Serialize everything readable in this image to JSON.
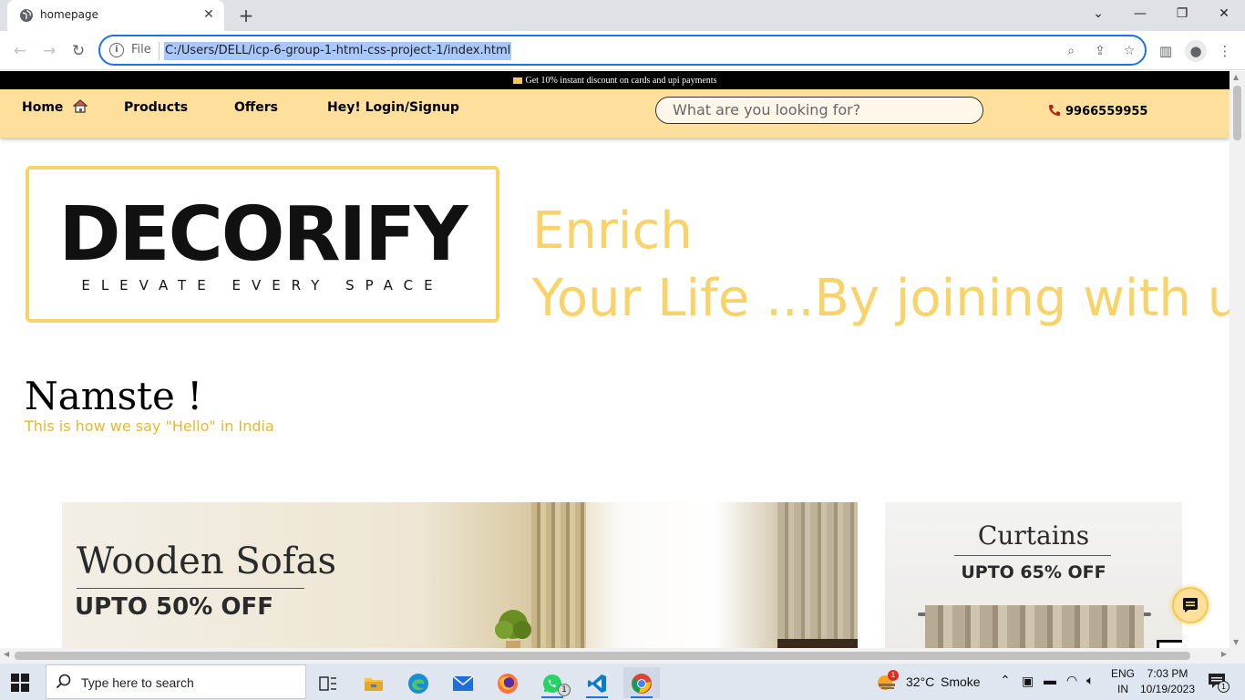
{
  "browser": {
    "tab_title": "homepage",
    "omnibox_scheme": "File",
    "url": "C:/Users/DELL/icp-6-group-1-html-css-project-1/index.html"
  },
  "site": {
    "promo": "Get 10% instant discount on cards and upi payments",
    "nav": {
      "home": "Home",
      "products": "Products",
      "offers": "Offers",
      "login": "Hey! Login/Signup"
    },
    "search_placeholder": "What are you looking for?",
    "phone": "9966559955",
    "logo_title": "DECORIFY",
    "logo_tagline": "ELEVATE EVERY SPACE",
    "hero_line1": "Enrich",
    "hero_line2": "Your Life ...By joining with us!",
    "greeting": "Namste !",
    "greeting_sub": "This is how we say \"Hello\" in India",
    "banners": [
      {
        "title": "Wooden Sofas",
        "offer": "UPTO 50% OFF"
      },
      {
        "title": "Curtains",
        "offer": "UPTO 65% OFF"
      }
    ]
  },
  "taskbar": {
    "search_placeholder": "Type here to search",
    "whatsapp_badge": "1",
    "weather_badge": "1",
    "temperature": "32°C",
    "weather": "Smoke",
    "lang": "ENG",
    "region": "IN",
    "time": "7:03 PM",
    "date": "10/19/2023",
    "notification_count": "1"
  },
  "colors": {
    "nav_bg": "#fedf9b",
    "accent_yellow": "#f9d36a",
    "greeting_sub": "#e7b731",
    "omnibox_border": "#1a73e8"
  }
}
